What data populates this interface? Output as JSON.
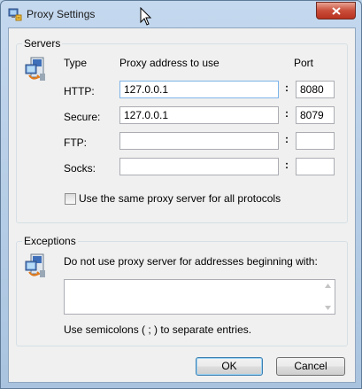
{
  "window": {
    "title": "Proxy Settings"
  },
  "servers": {
    "group_label": "Servers",
    "col_type": "Type",
    "col_address": "Proxy address to use",
    "col_port": "Port",
    "rows": [
      {
        "label": "HTTP:",
        "address": "127.0.0.1",
        "port": "8080"
      },
      {
        "label": "Secure:",
        "address": "127.0.0.1",
        "port": "8079"
      },
      {
        "label": "FTP:",
        "address": "",
        "port": ""
      },
      {
        "label": "Socks:",
        "address": "",
        "port": ""
      }
    ],
    "colon": ":",
    "same_proxy_label": "Use the same proxy server for all protocols",
    "same_proxy_checked": false
  },
  "exceptions": {
    "group_label": "Exceptions",
    "description": "Do not use proxy server for addresses beginning with:",
    "value": "",
    "hint": "Use semicolons ( ; ) to separate entries."
  },
  "buttons": {
    "ok": "OK",
    "cancel": "Cancel"
  },
  "icons": {
    "title": "network-settings-icon",
    "servers": "computer-network-icon",
    "exceptions": "computer-network-icon",
    "close": "close-icon"
  },
  "colors": {
    "close_button": "#c94e3a",
    "focus_border": "#7eb4ea"
  }
}
